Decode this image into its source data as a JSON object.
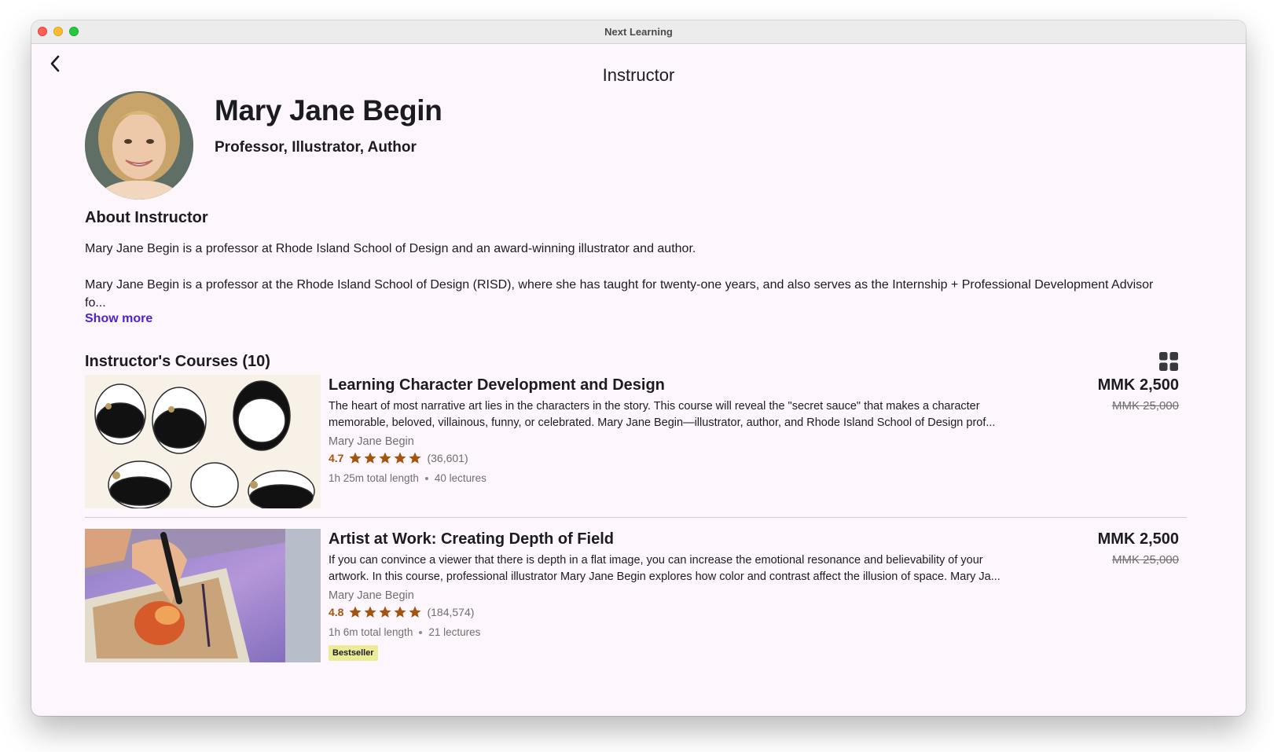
{
  "window": {
    "title": "Next Learning"
  },
  "appbar": {
    "title": "Instructor"
  },
  "instructor": {
    "name": "Mary Jane Begin",
    "headline": "Professor, Illustrator, Author"
  },
  "about": {
    "heading": "About Instructor",
    "paragraph_1": "Mary Jane Begin is a professor at Rhode Island School of Design and an award-winning illustrator and author.",
    "paragraph_2": "Mary Jane Begin is a professor at the Rhode Island School of Design (RISD), where she has taught for twenty-one years, and also serves as the Internship + Professional Development Advisor fo...",
    "show_more_label": "Show more"
  },
  "courses_section": {
    "title": "Instructor's Courses (10)",
    "view_toggle_icon": "grid-view-icon"
  },
  "courses": [
    {
      "title": "Learning Character Development and Design",
      "description": "The heart of most narrative art lies in the characters in the story. This course will reveal the \"secret sauce\" that makes a character memorable, beloved, villainous, funny, or celebrated. Mary Jane Begin—illustrator, author, and Rhode Island School of Design prof...",
      "author": "Mary Jane Begin",
      "rating": "4.7",
      "rating_value": 4.7,
      "rating_count": "(36,601)",
      "length": "1h 25m total length",
      "lectures": "40 lectures",
      "price": "MMK 2,500",
      "original_price": "MMK 25,000",
      "badge": ""
    },
    {
      "title": "Artist at Work: Creating Depth of Field",
      "description": "If you can convince a viewer that there is depth in a flat image, you can increase the emotional resonance and believability of your artwork. In this course, professional illustrator Mary Jane Begin explores how color and contrast affect the illusion of space. Mary Ja...",
      "author": "Mary Jane Begin",
      "rating": "4.8",
      "rating_value": 4.8,
      "rating_count": "(184,574)",
      "length": "1h 6m total length",
      "lectures": "21 lectures",
      "price": "MMK 2,500",
      "original_price": "MMK 25,000",
      "badge": "Bestseller"
    }
  ],
  "colors": {
    "background": "#fdf7fd",
    "accent_link": "#5022c8",
    "rating": "#a3540e",
    "badge_bg": "#eceb98"
  }
}
